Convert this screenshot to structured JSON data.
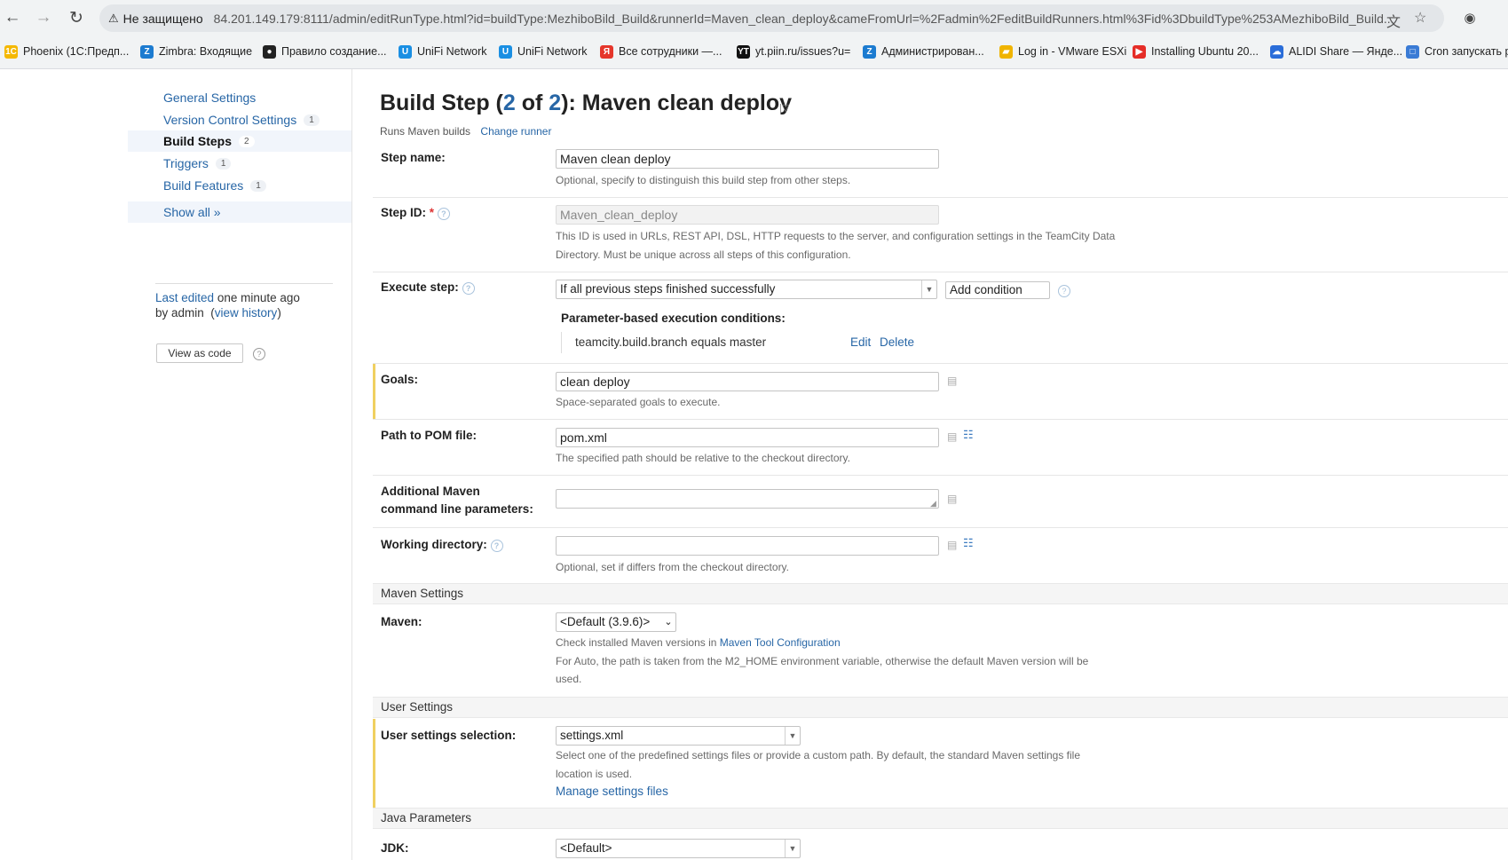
{
  "browser": {
    "security_label": "Не защищено",
    "url": "84.201.149.179:8111/admin/editRunType.html?id=buildType:MezhiboBild_Build&runnerId=Maven_clean_deploy&cameFromUrl=%2Fadmin%2FeditBuildRunners.html%3Fid%3DbuildType%253AMezhiboBild_Build...",
    "bookmarks": [
      {
        "label": "Phoenix (1С:Предп...",
        "icon": "1c-icon",
        "color": "#f5b800"
      },
      {
        "label": "Zimbra: Входящие",
        "icon": "zimbra-icon",
        "color": "#1c7bd0"
      },
      {
        "label": "Правило создание...",
        "icon": "github-icon",
        "color": "#222222"
      },
      {
        "label": "UniFi Network",
        "icon": "unifi-icon",
        "color": "#1a8fe3"
      },
      {
        "label": "UniFi Network",
        "icon": "unifi-icon",
        "color": "#1a8fe3"
      },
      {
        "label": "Все сотрудники —...",
        "icon": "yandex-icon",
        "color": "#e5362b"
      },
      {
        "label": "yt.piin.ru/issues?u=",
        "icon": "youtrack-icon",
        "color": "#111111"
      },
      {
        "label": "Администрирован...",
        "icon": "zimbra-icon",
        "color": "#1c7bd0"
      },
      {
        "label": "Log in - VMware ESXi",
        "icon": "vmware-icon",
        "color": "#f0b400"
      },
      {
        "label": "Installing Ubuntu 20...",
        "icon": "youtube-icon",
        "color": "#e52d27"
      },
      {
        "label": "ALIDI Share — Янде...",
        "icon": "yadisk-icon",
        "color": "#2a6dd9"
      },
      {
        "label": "Cron запускать р",
        "icon": "site-icon",
        "color": "#3a7bd5"
      }
    ]
  },
  "sidebar": {
    "items": [
      {
        "label": "General Settings",
        "count": ""
      },
      {
        "label": "Version Control Settings",
        "count": "1"
      },
      {
        "label": "Build Steps",
        "count": "2"
      },
      {
        "label": "Triggers",
        "count": "1"
      },
      {
        "label": "Build Features",
        "count": "1"
      },
      {
        "label": "Show all »",
        "count": ""
      }
    ],
    "last_edited_link": "Last edited",
    "last_edited_time": "one minute ago",
    "by_admin": "by admin",
    "view_history": "view history",
    "view_as_code": "View as code"
  },
  "header": {
    "title_prefix": "Build Step (",
    "step_num": "2",
    "of": " of ",
    "total": "2",
    "title_suffix": "): Maven clean deploy",
    "subtitle": "Runs Maven builds",
    "change_runner": "Change runner"
  },
  "form": {
    "step_name_label": "Step name:",
    "step_name_value": "Maven clean deploy",
    "step_name_hint": "Optional, specify to distinguish this build step from other steps.",
    "step_id_label": "Step ID:",
    "step_id_required": "*",
    "step_id_value": "Maven_clean_deploy",
    "step_id_hint_1": "This ID is used in URLs, REST API, DSL, HTTP requests to the server, and configuration settings in the TeamCity Data",
    "step_id_hint_2": "Directory. Must be unique across all steps of this configuration.",
    "execute_label": "Execute step:",
    "execute_value": "If all previous steps finished successfully",
    "add_condition": "Add condition",
    "param_conditions_title": "Parameter-based execution conditions:",
    "condition_text": "teamcity.build.branch equals master",
    "condition_edit": "Edit",
    "condition_delete": "Delete",
    "goals_label": "Goals:",
    "goals_value": "clean deploy",
    "goals_hint": "Space-separated goals to execute.",
    "pom_label": "Path to POM file:",
    "pom_value": "pom.xml",
    "pom_hint": "The specified path should be relative to the checkout directory.",
    "addl_label_1": "Additional Maven",
    "addl_label_2": "command line parameters:",
    "addl_value": "",
    "workdir_label": "Working directory:",
    "workdir_value": "",
    "workdir_hint": "Optional, set if differs from the checkout directory.",
    "maven_settings_section": "Maven Settings",
    "maven_label": "Maven:",
    "maven_value": "<Default (3.9.6)>",
    "maven_hint_prefix": "Check installed Maven versions in",
    "maven_hint_link": "Maven Tool Configuration",
    "maven_hint_2a": "For Auto, the path is taken from the M2_HOME environment variable, otherwise the default Maven version will be",
    "maven_hint_2b": "used.",
    "user_settings_section": "User Settings",
    "user_settings_label": "User settings selection:",
    "user_settings_value": "settings.xml",
    "user_settings_hint_1": "Select one of the predefined settings files or provide a custom path. By default, the standard Maven settings file",
    "user_settings_hint_2": "location is used.",
    "manage_settings": "Manage settings files",
    "java_section": "Java Parameters",
    "jdk_label": "JDK:",
    "jdk_value": "<Default>"
  }
}
